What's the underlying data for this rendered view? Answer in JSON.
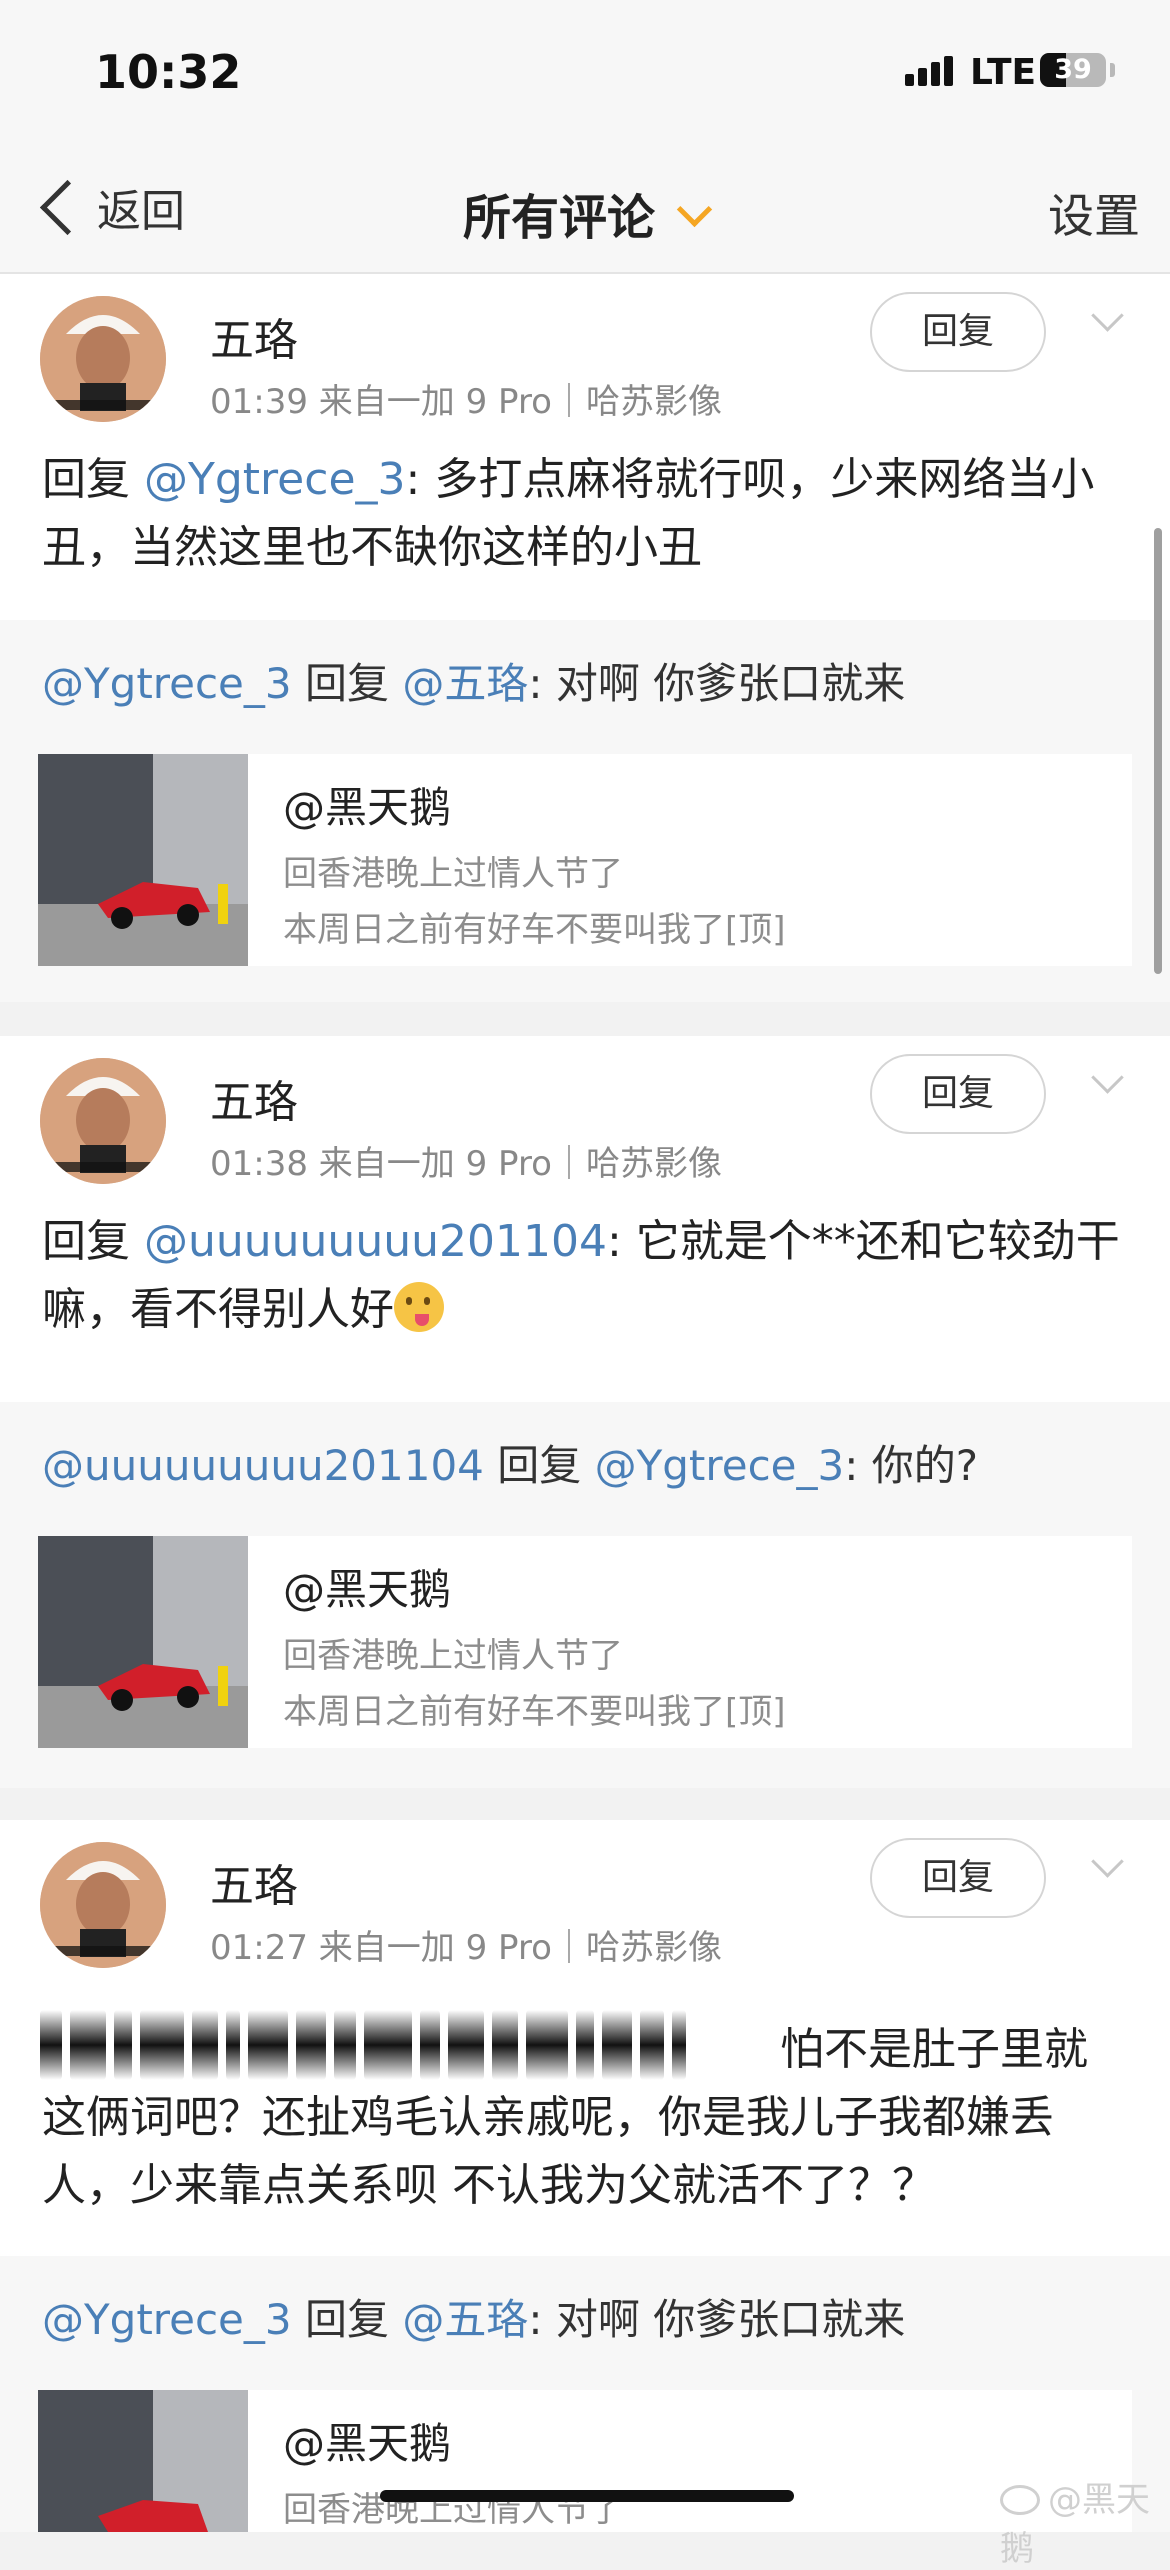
{
  "status": {
    "time": "10:32",
    "network": "LTE",
    "battery": "39",
    "battery_level": 0.39
  },
  "nav": {
    "back": "返回",
    "title": "所有评论",
    "settings": "设置"
  },
  "comments": [
    {
      "author": "五珞",
      "meta": "01:39 来自一加 9 Pro｜哈苏影像",
      "reply_btn": "回复",
      "body_prefix": "回复 ",
      "mention": "@Ygtrece_3",
      "body": ": 多打点麻将就行呗，少来网络当小丑，当然这里也不缺你这样的小丑",
      "quote": {
        "from": "@Ygtrece_3",
        "verb": " 回复 ",
        "to": "@五珞",
        "text": ": 对啊 你爹张口就来"
      },
      "card": {
        "title": "@黑天鹅",
        "line1": "回香港晚上过情人节了",
        "line2": "本周日之前有好车不要叫我了[顶]"
      }
    },
    {
      "author": "五珞",
      "meta": "01:38 来自一加 9 Pro｜哈苏影像",
      "reply_btn": "回复",
      "body_prefix": "回复 ",
      "mention": "@uuuuuuuuu201104",
      "body": ": 它就是个**还和它较劲干嘛，看不得别人好",
      "quote": {
        "from": "@uuuuuuuuu201104",
        "verb": " 回复 ",
        "to": "@Ygtrece_3",
        "text": ": 你的?"
      },
      "card": {
        "title": "@黑天鹅",
        "line1": "回香港晚上过情人节了",
        "line2": "本周日之前有好车不要叫我了[顶]"
      }
    },
    {
      "author": "五珞",
      "meta": "01:27 来自一加 9 Pro｜哈苏影像",
      "reply_btn": "回复",
      "body_tail_line1": "怕不是肚子里就",
      "body_rest": "这俩词吧？还扯鸡毛认亲戚呢，你是我儿子我都嫌丢人，少来靠点关系呗  不认我为父就活不了？？",
      "quote": {
        "from": "@Ygtrece_3",
        "verb": " 回复 ",
        "to": "@五珞",
        "text": ": 对啊 你爹张口就来"
      },
      "card": {
        "title": "@黑天鹅",
        "line1": "回香港晚上过情人节了"
      }
    }
  ],
  "watermark": "@黑天鹅",
  "icons": {
    "back": "chevron-left-icon",
    "title_dropdown": "chevron-down-icon",
    "more": "chevron-down-icon",
    "emoji": "tongue-out-emoji"
  },
  "colors": {
    "mention": "#4a7fb7",
    "accent": "#f5a623"
  }
}
